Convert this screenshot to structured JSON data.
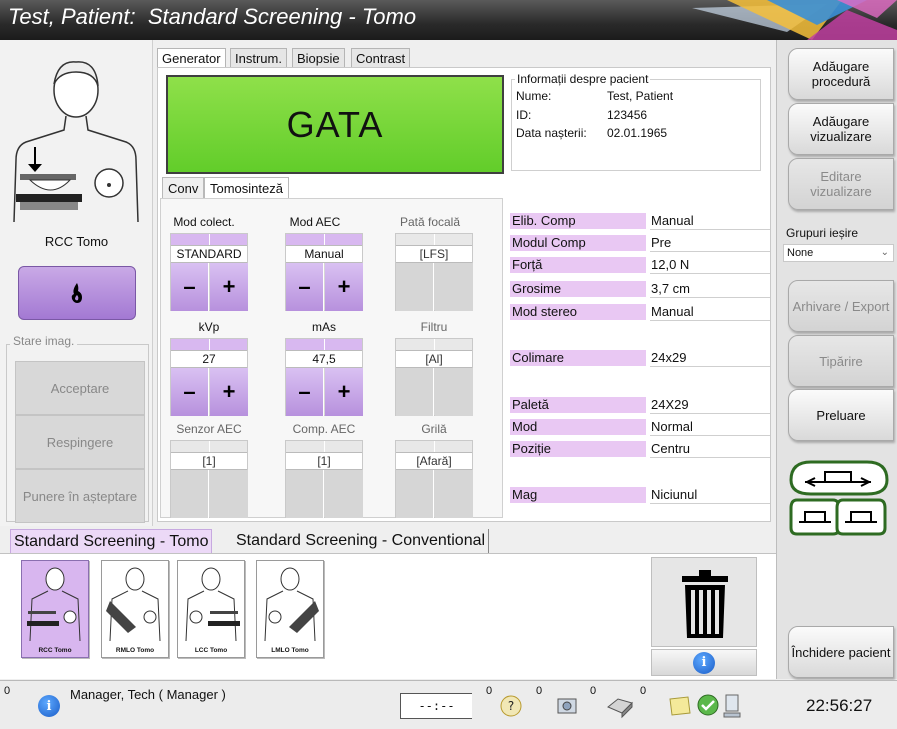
{
  "title": "Test, Patient:  Standard Screening - Tomo",
  "left": {
    "view_label": "RCC Tomo",
    "stare_legend": "Stare imag.",
    "accept": "Acceptare",
    "reject": "Respingere",
    "pending": "Punere în așteptare"
  },
  "tabs": [
    "Generator",
    "Instrum.",
    "Biopsie",
    "Contrast"
  ],
  "status_banner": "GATA",
  "patient": {
    "legend": "Informații despre pacient",
    "name_label": "Nume:",
    "name": "Test, Patient",
    "id_label": "ID:",
    "id": "123456",
    "dob_label": "Data nașterii:",
    "dob": "02.01.1965"
  },
  "subtabs": [
    "Conv",
    "Tomosinteză"
  ],
  "controls": {
    "mod_colect": {
      "label": "Mod colect.",
      "value": "STANDARD"
    },
    "mod_aec": {
      "label": "Mod AEC",
      "value": "Manual"
    },
    "pata_focala": {
      "label": "Pată focală",
      "value": "[LFS]"
    },
    "kvp": {
      "label": "kVp",
      "value": "27"
    },
    "mas": {
      "label": "mAs",
      "value": "47,5"
    },
    "filtru": {
      "label": "Filtru",
      "value": "[Al]"
    },
    "senzor_aec": {
      "label": "Senzor AEC",
      "value": "[1]"
    },
    "comp_aec": {
      "label": "Comp. AEC",
      "value": "[1]"
    },
    "grila": {
      "label": "Grilă",
      "value": "[Afară]"
    },
    "minus": "–",
    "plus": "+"
  },
  "params": [
    {
      "k": "Elib. Comp",
      "v": "Manual"
    },
    {
      "k": "Modul Comp",
      "v": "Pre"
    },
    {
      "k": "Forță",
      "v": "12,0 N"
    },
    {
      "k": "Grosime",
      "v": "3,7 cm"
    },
    {
      "k": "Mod stereo",
      "v": "Manual"
    },
    {
      "k": "Colimare",
      "v": "24x29"
    },
    {
      "k": "Paletă",
      "v": "24X29"
    },
    {
      "k": "Mod",
      "v": "Normal"
    },
    {
      "k": "Poziție",
      "v": "Centru"
    },
    {
      "k": "Mag",
      "v": "Niciunul"
    }
  ],
  "right": {
    "add_procedure": "Adăugare procedură",
    "add_view": "Adăugare vizualizare",
    "edit_view": "Editare vizualizare",
    "output_groups": "Grupuri ieșire",
    "output_select": "None",
    "archive": "Arhivare / Export",
    "print": "Tipărire",
    "retrieve": "Preluare",
    "close_patient": "Închidere pacient"
  },
  "procedure_tabs": [
    "Standard Screening - Tomo",
    "Standard Screening - Conventional"
  ],
  "thumbs": [
    "RCC Tomo",
    "RMLO Tomo",
    "LCC Tomo",
    "LMLO Tomo"
  ],
  "status": {
    "user": "Manager, Tech ( Manager )",
    "info_count": "0",
    "timer": "--:--",
    "timer_count": "0",
    "help_count": "0",
    "media_count": "0",
    "printer_count": "0",
    "clock": "22:56:27"
  }
}
